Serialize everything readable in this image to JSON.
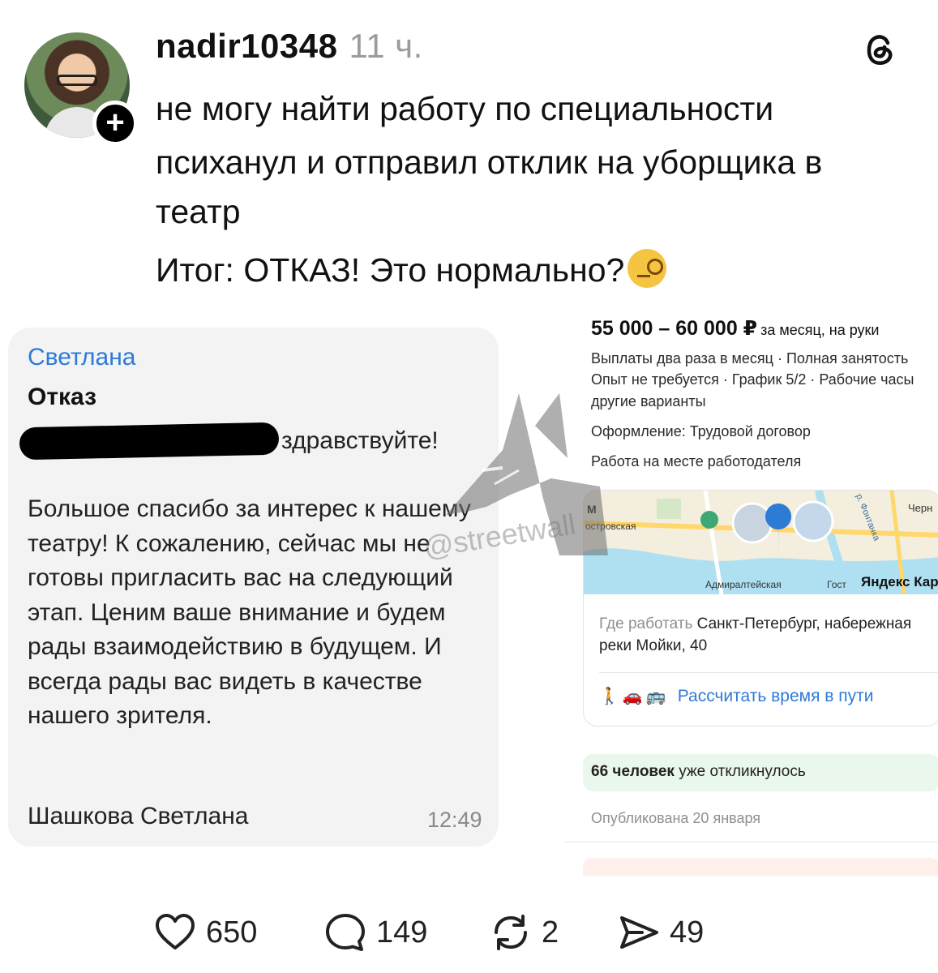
{
  "post": {
    "username": "nadir10348",
    "time": "11 ч.",
    "lines": [
      "не могу найти работу по специальности",
      "психанул и отправил отклик на уборщика в театр",
      "Итог: ОТКАЗ! Это нормально?"
    ]
  },
  "message": {
    "sender": "Светлана",
    "subject": "Отказ",
    "greeting": "здравствуйте!",
    "body": "Большое спасибо за интерес к нашему театру! К сожалению, сейчас мы не готовы пригласить вас на следующий этап. Ценим ваше внимание и будем рады взаимодействию в будущем. И всегда рады вас видеть в качестве нашего зрителя.",
    "signature": "Шашкова Светлана",
    "time": "12:49"
  },
  "vacancy": {
    "salary": "55 000 – 60 000 ₽",
    "salary_note": "за месяц, на руки",
    "conditions": [
      "Выплаты два раза в месяц · Полная занятость",
      "Опыт не требуется · График 5/2 · Рабочие часы",
      "другие варианты"
    ],
    "contract": "Оформление: Трудовой договор",
    "location_type": "Работа на месте работодателя",
    "map": {
      "label_left": "островская",
      "label_bottom": "Адмиралтейская",
      "label_gost": "Гост",
      "label_yandex": "Яндекс Кар",
      "label_river": "р. Фонтанка",
      "label_chern": "Черн"
    },
    "workplace_label": "Где работать",
    "workplace_address": "Санкт-Петербург, набережная реки Мойки, 40",
    "route_link": "Рассчитать время в пути",
    "responses_count": "66 человек",
    "responses_suffix": "уже откликнулось",
    "published": "Опубликована 20 января"
  },
  "watermark": "@streetwall",
  "actions": {
    "likes": "650",
    "comments": "149",
    "reposts": "2",
    "shares": "49"
  },
  "colors": {
    "link_blue": "#2e7bd6",
    "muted": "#9b9b9b",
    "card_bg": "#f3f3f4",
    "banner_green": "#eaf7ec"
  }
}
